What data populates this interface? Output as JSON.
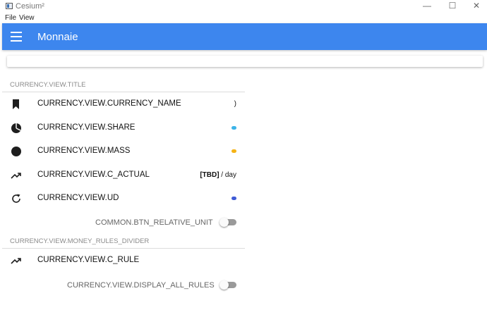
{
  "window": {
    "title": "Cesium²",
    "minimize": "—",
    "maximize": "☐",
    "close": "✕"
  },
  "menu": {
    "file": "File",
    "view": "View"
  },
  "appbar": {
    "title": "Monnaie"
  },
  "section1": {
    "title": "CURRENCY.VIEW.TITLE",
    "rows": [
      {
        "label": "CURRENCY.VIEW.CURRENCY_NAME",
        "note": ")"
      },
      {
        "label": "CURRENCY.VIEW.SHARE"
      },
      {
        "label": "CURRENCY.VIEW.MASS"
      },
      {
        "label": "CURRENCY.VIEW.C_ACTUAL",
        "note_bold": "[TBD]",
        "note": " / day"
      },
      {
        "label": "CURRENCY.VIEW.UD"
      }
    ],
    "toggle_label": "COMMON.BTN_RELATIVE_UNIT",
    "toggle_on": false
  },
  "section2": {
    "title": "CURRENCY.VIEW.MONEY_RULES_DIVIDER",
    "rows": [
      {
        "label": "CURRENCY.VIEW.C_RULE"
      }
    ],
    "toggle_label": "CURRENCY.VIEW.DISPLAY_ALL_RULES",
    "toggle_on": false
  },
  "colors": {
    "appbar": "#3d86ee",
    "share_badge": "#3cb4e8",
    "mass_badge": "#f5b316",
    "ud_badge": "#3f5bd6"
  },
  "icons": {
    "bookmark": "bookmark-icon",
    "pie": "pie-chart-icon",
    "circle": "circle-icon",
    "trend": "trending-up-icon",
    "refresh": "refresh-icon"
  }
}
